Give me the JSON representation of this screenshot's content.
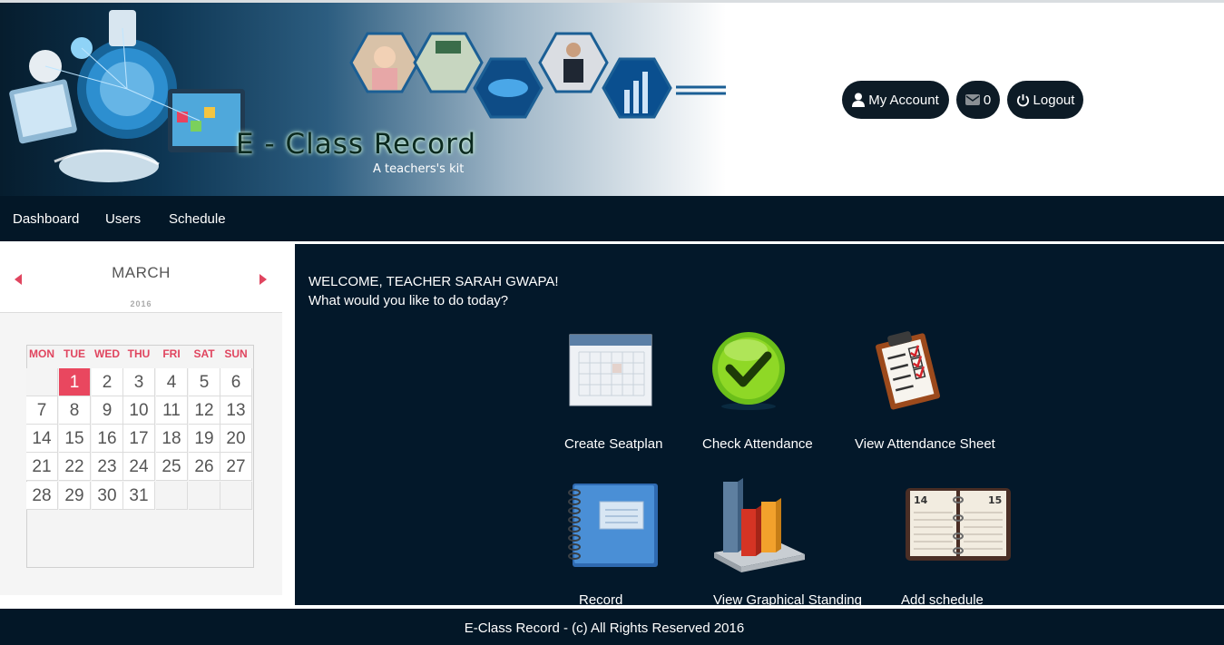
{
  "header": {
    "title": "E - Class Record",
    "tagline": "A teachers's kit",
    "account_label": "My Account",
    "message_count": "0",
    "logout_label": "Logout"
  },
  "nav": {
    "items": [
      "Dashboard",
      "Users",
      "Schedule"
    ]
  },
  "calendar": {
    "month": "MARCH",
    "year": "2016",
    "weekdays": [
      "MON",
      "TUE",
      "WED",
      "THU",
      "FRI",
      "SAT",
      "SUN"
    ],
    "days": [
      "",
      "1",
      "2",
      "3",
      "4",
      "5",
      "6",
      "7",
      "8",
      "9",
      "10",
      "11",
      "12",
      "13",
      "14",
      "15",
      "16",
      "17",
      "18",
      "19",
      "20",
      "21",
      "22",
      "23",
      "24",
      "25",
      "26",
      "27",
      "28",
      "29",
      "30",
      "31",
      "",
      "",
      ""
    ],
    "today": "1"
  },
  "main": {
    "welcome": "WELCOME, TEACHER SARAH GWAPA!",
    "question": "What would you like to do today?",
    "actions": [
      "Create Seatplan",
      "Check Attendance",
      "View Attendance Sheet",
      "Record",
      "View Graphical Standing",
      "Add schedule"
    ]
  },
  "footer": {
    "text": "E-Class Record - (c) All Rights Reserved 2016"
  },
  "colors": {
    "dark_navy": "#031727",
    "accent_red": "#e9475f",
    "button_bg": "#0d1b26"
  }
}
